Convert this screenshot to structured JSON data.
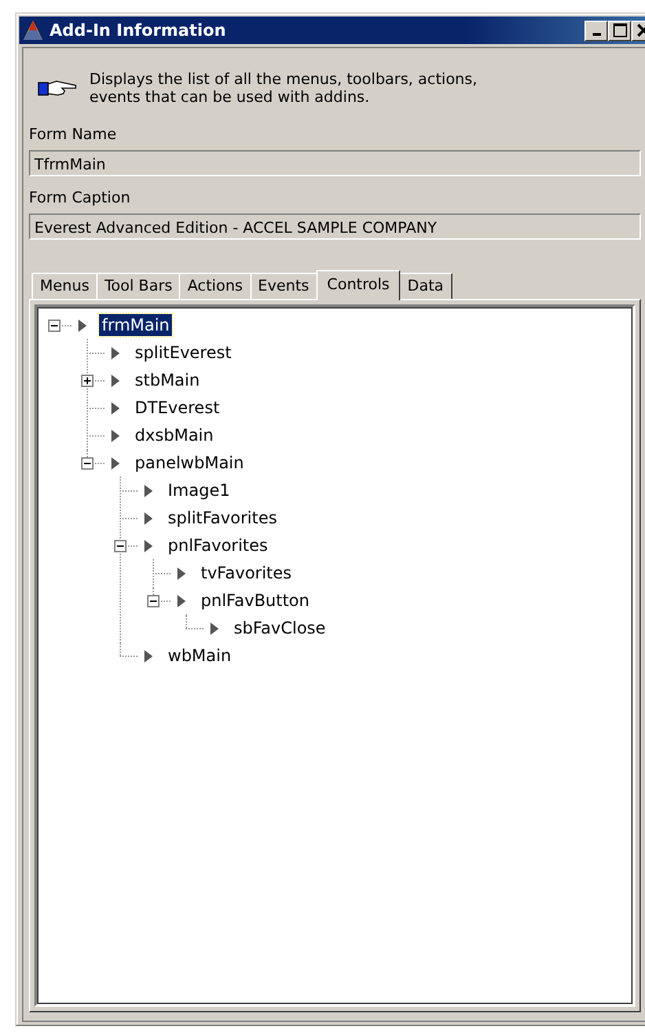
{
  "window": {
    "title": "Add-In Information"
  },
  "description": "Displays the list of all the menus, toolbars, actions, events that can be used with addins.",
  "fields": [
    {
      "label": "Form Name",
      "value": "TfrmMain"
    },
    {
      "label": "Form Caption",
      "value": "Everest Advanced Edition - ACCEL SAMPLE COMPANY"
    }
  ],
  "tabs": [
    {
      "label": "Menus",
      "selected": false
    },
    {
      "label": "Tool Bars",
      "selected": false
    },
    {
      "label": "Actions",
      "selected": false
    },
    {
      "label": "Events",
      "selected": false
    },
    {
      "label": "Controls",
      "selected": true
    },
    {
      "label": "Data",
      "selected": false
    }
  ],
  "tree": [
    {
      "label": "frmMain",
      "selected": true,
      "expanded": true,
      "children": [
        {
          "label": "splitEverest",
          "selected": false
        },
        {
          "label": "stbMain",
          "selected": false,
          "expanded": false
        },
        {
          "label": "DTEverest",
          "selected": false
        },
        {
          "label": "dxsbMain",
          "selected": false
        },
        {
          "label": "panelwbMain",
          "selected": false,
          "expanded": true,
          "children": [
            {
              "label": "Image1",
              "selected": false
            },
            {
              "label": "splitFavorites",
              "selected": false
            },
            {
              "label": "pnlFavorites",
              "selected": false,
              "expanded": true,
              "children": [
                {
                  "label": "tvFavorites",
                  "selected": false
                },
                {
                  "label": "pnlFavButton",
                  "selected": false,
                  "expanded": true,
                  "children": [
                    {
                      "label": "sbFavClose",
                      "selected": false
                    }
                  ]
                }
              ]
            },
            {
              "label": "wbMain",
              "selected": false
            }
          ]
        }
      ]
    }
  ]
}
